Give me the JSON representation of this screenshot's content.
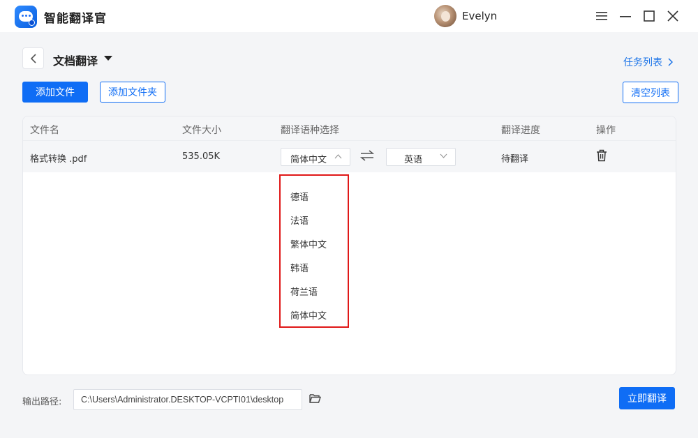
{
  "app": {
    "title": "智能翻译官"
  },
  "user": {
    "name": "Evelyn"
  },
  "page": {
    "title": "文档翻译",
    "task_list": "任务列表"
  },
  "toolbar": {
    "add_file": "添加文件",
    "add_folder": "添加文件夹",
    "clear_list": "清空列表"
  },
  "table": {
    "columns": [
      "文件名",
      "文件大小",
      "翻译语种选择",
      "翻译进度",
      "操作"
    ],
    "rows": [
      {
        "name": "格式转换 .pdf",
        "size": "535.05K",
        "source_lang": "简体中文",
        "target_lang": "英语",
        "status": "待翻译"
      }
    ]
  },
  "dropdown": {
    "options": [
      "德语",
      "法语",
      "繁体中文",
      "韩语",
      "荷兰语",
      "简体中文"
    ]
  },
  "footer": {
    "output_label": "输出路径:",
    "output_path": "C:\\Users\\Administrator.DESKTOP-VCPTI01\\desktop",
    "translate_now": "立即翻译"
  },
  "colors": {
    "accent": "#0f6df5",
    "highlight_border": "#e01717"
  }
}
